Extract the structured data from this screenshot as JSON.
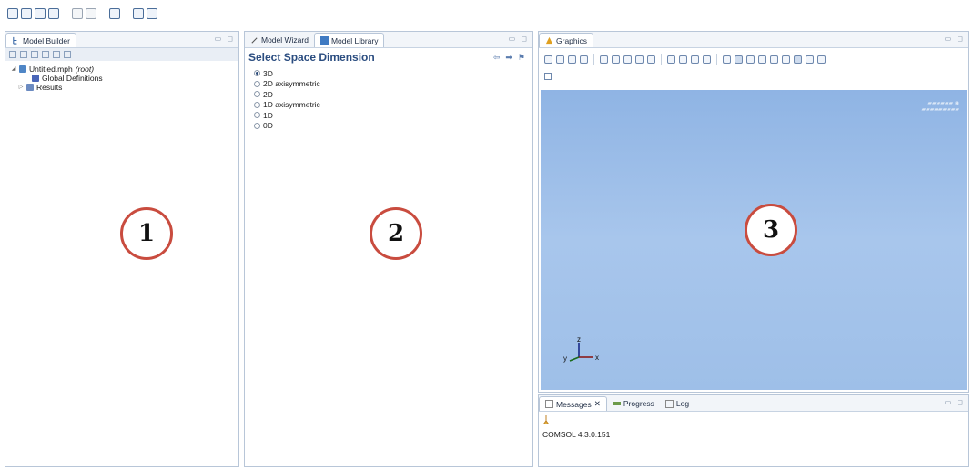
{
  "panels": {
    "model_builder": {
      "tab_label": "Model Builder",
      "tree": {
        "root_name": "Untitled.mph",
        "root_suffix": "(root)",
        "children": [
          {
            "label": "Global Definitions"
          },
          {
            "label": "Results"
          }
        ]
      }
    },
    "wizard": {
      "tabs": [
        {
          "label": "Model Wizard"
        },
        {
          "label": "Model Library"
        }
      ],
      "title": "Select Space Dimension",
      "options": [
        {
          "label": "3D",
          "selected": true
        },
        {
          "label": "2D axisymmetric",
          "selected": false
        },
        {
          "label": "2D",
          "selected": false
        },
        {
          "label": "1D axisymmetric",
          "selected": false
        },
        {
          "label": "1D",
          "selected": false
        },
        {
          "label": "0D",
          "selected": false
        }
      ]
    },
    "graphics": {
      "tab_label": "Graphics",
      "axis_labels": {
        "x": "x",
        "y": "y",
        "z": "z"
      },
      "logo_icon": "comsol-logo-icon"
    },
    "messages": {
      "tabs": [
        {
          "label": "Messages"
        },
        {
          "label": "Progress"
        },
        {
          "label": "Log"
        }
      ],
      "text": "COMSOL 4.3.0.151"
    }
  },
  "callouts": [
    "1",
    "2",
    "3"
  ],
  "colors": {
    "graphics_bg": "#9ebfe8",
    "callout_ring": "#c94c3f",
    "title_blue": "#2b4d80"
  }
}
